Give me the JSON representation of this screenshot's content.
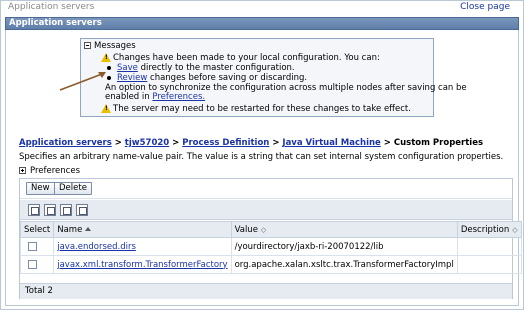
{
  "page": {
    "title": "Application servers",
    "close_link": "Close page"
  },
  "panel": {
    "title": "Application servers"
  },
  "messages": {
    "header": "Messages",
    "line1": "Changes have been made to your local configuration. You can:",
    "save_link": "Save",
    "save_rest": " directly to the master configuration.",
    "review_link": "Review",
    "review_rest": " changes before saving or discarding.",
    "sync_line1": "An option to synchronize the configuration across multiple nodes after saving can be",
    "sync_line2_pre": "enabled in ",
    "preferences_link": "Preferences.",
    "restart": "The server may need to be restarted for these changes to take effect."
  },
  "breadcrumb": {
    "items": [
      "Application servers",
      "tjw57020",
      "Process Definition",
      "Java Virtual Machine"
    ],
    "separator": " > ",
    "current": "Custom Properties"
  },
  "description": "Specifies an arbitrary name-value pair. The value is a string that can set internal system configuration properties.",
  "preferences_label": "Preferences",
  "buttons": {
    "new": "New",
    "delete": "Delete"
  },
  "table": {
    "headers": {
      "select": "Select",
      "name": "Name",
      "value": "Value",
      "description": "Description"
    },
    "rows": [
      {
        "name": "java.endorsed.dirs",
        "value": "/yourdirectory/jaxb-ri-20070122/lib",
        "description": ""
      },
      {
        "name": "javax.xml.transform.TransformerFactory",
        "value": "org.apache.xalan.xsltc.trax.TransformerFactoryImpl",
        "description": ""
      }
    ],
    "total": "Total 2"
  },
  "colors": {
    "panel_bar": "#5f7fa9",
    "link": "#1a33a6",
    "warning": "#e8c000",
    "arrow": "#8a5a2b"
  }
}
